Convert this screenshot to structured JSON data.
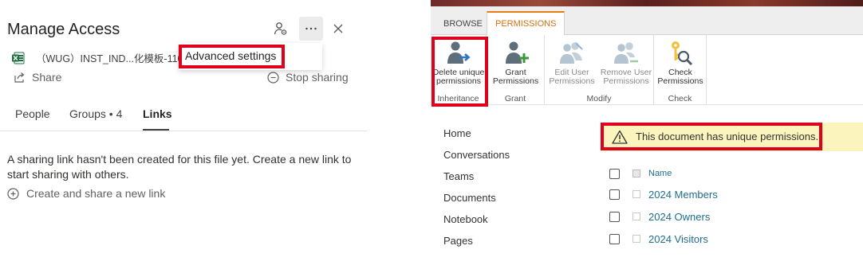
{
  "left_panel": {
    "title": "Manage Access",
    "file_name": "（WUG）INST_IND...化模板-1108.x",
    "share_label": "Share",
    "stop_sharing_label": "Stop sharing",
    "more_menu": {
      "item": "Advanced settings"
    },
    "tabs": [
      {
        "label": "People",
        "active": false
      },
      {
        "label": "Groups • 4",
        "active": false
      },
      {
        "label": "Links",
        "active": true
      }
    ],
    "empty_message": "A sharing link hasn't been created for this file yet. Create a new link to start sharing with others.",
    "create_link_label": "Create and share a new link"
  },
  "right_panel": {
    "tabs": [
      {
        "label": "BROWSE",
        "active": false
      },
      {
        "label": "PERMISSIONS",
        "active": true
      }
    ],
    "ribbon": {
      "groups": [
        {
          "label": "Inheritance",
          "buttons": [
            {
              "line1": "Delete unique",
              "line2": "permissions",
              "enabled": true
            }
          ]
        },
        {
          "label": "Grant",
          "buttons": [
            {
              "line1": "Grant",
              "line2": "Permissions",
              "enabled": true
            }
          ]
        },
        {
          "label": "Modify",
          "buttons": [
            {
              "line1": "Edit User",
              "line2": "Permissions",
              "enabled": false
            },
            {
              "line1": "Remove User",
              "line2": "Permissions",
              "enabled": false
            }
          ]
        },
        {
          "label": "Check",
          "buttons": [
            {
              "line1": "Check",
              "line2": "Permissions",
              "enabled": true
            }
          ]
        }
      ]
    },
    "nav": [
      "Home",
      "Conversations",
      "Teams",
      "Documents",
      "Notebook",
      "Pages"
    ],
    "notice": "This document has unique permissions.",
    "table": {
      "header": "Name",
      "rows": [
        "2024 Members",
        "2024 Owners",
        "2024 Visitors"
      ]
    }
  },
  "colors": {
    "highlight": "#e0001b",
    "ribbon_accent": "#d5700e",
    "link": "#1f6d8c",
    "notice_bg": "#fbf4bc",
    "excel": "#1d6f42"
  }
}
